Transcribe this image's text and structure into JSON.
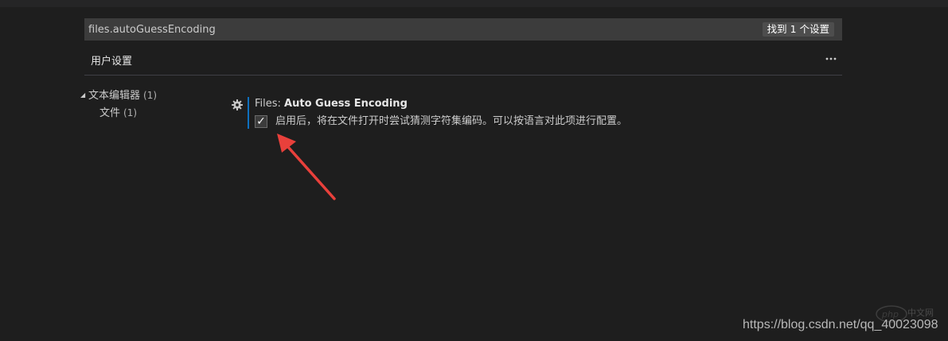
{
  "search": {
    "value": "files.autoGuessEncoding",
    "result_count": "找到 1 个设置"
  },
  "tabs": [
    {
      "label": "用户设置",
      "active": true
    }
  ],
  "more_menu_icon": "ellipsis-icon",
  "toc": {
    "group": {
      "label": "文本编辑器",
      "count": "(1)",
      "expanded": true
    },
    "child": {
      "label": "文件",
      "count": "(1)"
    }
  },
  "setting": {
    "category": "Files: ",
    "name": "Auto Guess Encoding",
    "checked": true,
    "check_glyph": "✓",
    "description": "启用后，将在文件打开时尝试猜测字符集编码。可以按语言对此项进行配置。"
  },
  "annotation": {
    "arrow_color": "#e8403b"
  },
  "watermark": {
    "logo_text": "php",
    "site": "中文网",
    "url": "https://blog.csdn.net/qq_40023098"
  },
  "colors": {
    "background": "#1e1e1e",
    "input_bg": "#3c3c3c",
    "accent": "#0e70c0"
  }
}
